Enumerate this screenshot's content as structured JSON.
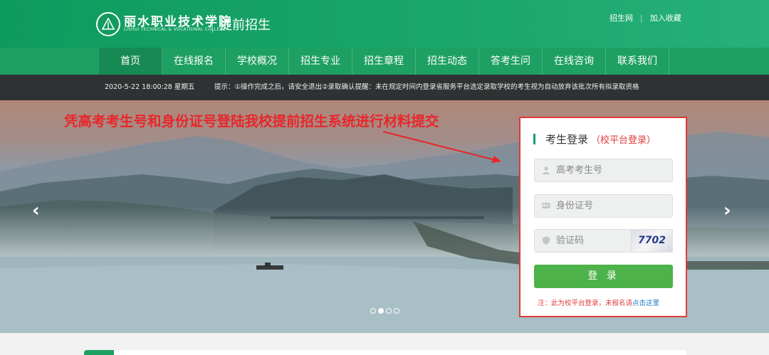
{
  "header": {
    "logo_cn": "丽水职业技术学院",
    "logo_en": "LISHUI TECHNICAL & VOCATIONAL COLLEGE",
    "site_name": "提前招生",
    "links": [
      "招生网",
      "加入收藏"
    ]
  },
  "nav": {
    "items": [
      "首页",
      "在线报名",
      "学校概况",
      "招生专业",
      "招生章程",
      "招生动态",
      "答考生问",
      "在线咨询",
      "联系我们"
    ],
    "active_index": 0
  },
  "notice": {
    "datetime": "2020-5-22 18:00:28 星期五",
    "tip": "提示：①操作完成之后，请安全退出②录取确认提醒：未在规定时间内登录省服务平台选定录取学校的考生视为自动放弃该批次所有拟录取资格"
  },
  "banner": {
    "headline": "凭高考考生号和身份证号登陆我校提前招生系统进行材料提交",
    "prev_arrow": "‹",
    "next_arrow": "›",
    "slides": 4,
    "active_slide": 1
  },
  "login": {
    "title": "考生登录",
    "subtitle": "（校平台登录）",
    "exam_no_placeholder": "高考考生号",
    "id_card_placeholder": "身份证号",
    "captcha_placeholder": "验证码",
    "captcha_value": "7702",
    "submit_label": "登 录",
    "note_prefix": "注：此为校平台登录，未报名请",
    "note_link": "点击这里"
  },
  "colors": {
    "primary_green": "#1ea062",
    "button_green": "#4cb249",
    "alert_red": "#e23a3a",
    "notice_bg": "#2f3233"
  },
  "icons": [
    "logo-emblem-icon",
    "user-icon",
    "id-card-icon",
    "shield-icon",
    "chevron-left-icon",
    "chevron-right-icon"
  ]
}
